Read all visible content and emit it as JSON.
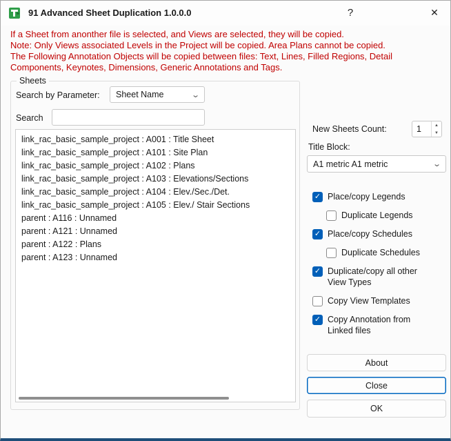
{
  "window": {
    "title": "91 Advanced Sheet Duplication 1.0.0.0",
    "help_button": "?",
    "close_button": "✕"
  },
  "notice": {
    "line1": "If a Sheet from anonther file is selected, and Views are selected, they will be copied.",
    "line2": "Note: Only Views associated Levels in the Project will be copied. Area Plans cannot be copied.",
    "line3": "The Following Annotation Objects will be copied between files: Text, Lines, Filled Regions, Detail Components, Keynotes, Dimensions, Generic Annotations and Tags."
  },
  "sheets_group": {
    "title": "Sheets",
    "search_by_parameter_label": "Search by Parameter:",
    "parameter_value": "Sheet Name",
    "search_label": "Search",
    "search_value": "",
    "items": [
      "link_rac_basic_sample_project : A001 : Title Sheet",
      "link_rac_basic_sample_project : A101 : Site Plan",
      "link_rac_basic_sample_project : A102 : Plans",
      "link_rac_basic_sample_project : A103 : Elevations/Sections",
      "link_rac_basic_sample_project : A104 : Elev./Sec./Det.",
      "link_rac_basic_sample_project : A105 : Elev./ Stair Sections",
      "parent : A116 : Unnamed",
      "parent : A121 : Unnamed",
      "parent : A122 : Plans",
      "parent : A123 : Unnamed"
    ]
  },
  "options": {
    "new_sheets_count_label": "New Sheets Count:",
    "new_sheets_count_value": "1",
    "title_block_label": "Title Block:",
    "title_block_value": "A1 metric A1 metric",
    "checkboxes": [
      {
        "label": "Place/copy Legends",
        "checked": true,
        "indent": false
      },
      {
        "label": "Duplicate Legends",
        "checked": false,
        "indent": true
      },
      {
        "label": "Place/copy Schedules",
        "checked": true,
        "indent": false
      },
      {
        "label": "Duplicate Schedules",
        "checked": false,
        "indent": true
      },
      {
        "label": "Duplicate/copy all other View Types",
        "checked": true,
        "indent": false
      },
      {
        "label": "Copy View Templates",
        "checked": false,
        "indent": false
      },
      {
        "label": "Copy Annotation from Linked files",
        "checked": true,
        "indent": false
      }
    ]
  },
  "buttons": {
    "about": "About",
    "close": "Close",
    "ok": "OK"
  },
  "colors": {
    "accent": "#005fb8",
    "notice_text": "#c00000",
    "default_button_border": "#0067c0"
  }
}
